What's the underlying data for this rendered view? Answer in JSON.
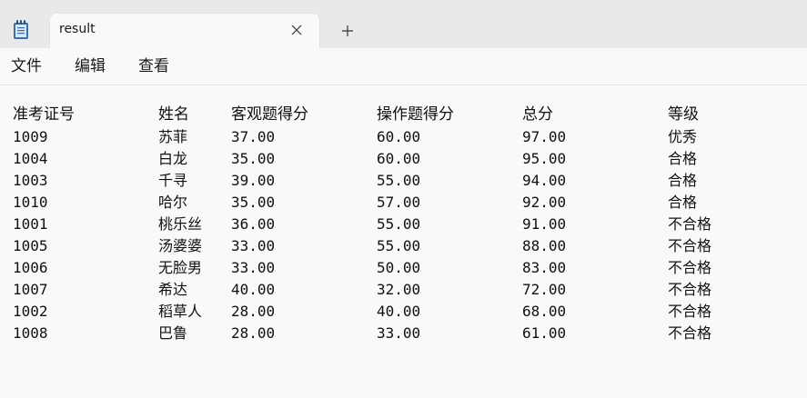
{
  "window": {
    "tab_title": "result",
    "icons": {
      "app": "notepad-icon",
      "close": "close-icon",
      "new_tab": "plus-icon"
    }
  },
  "menu": {
    "file": "文件",
    "edit": "编辑",
    "view": "查看"
  },
  "document": {
    "headers": [
      "准考证号",
      "姓名",
      "客观题得分",
      "操作题得分",
      "总分",
      "等级"
    ],
    "rows": [
      [
        "1009",
        "苏菲",
        "37.00",
        "60.00",
        "97.00",
        "优秀"
      ],
      [
        "1004",
        "白龙",
        "35.00",
        "60.00",
        "95.00",
        "合格"
      ],
      [
        "1003",
        "千寻",
        "39.00",
        "55.00",
        "94.00",
        "合格"
      ],
      [
        "1010",
        "哈尔",
        "35.00",
        "57.00",
        "92.00",
        "合格"
      ],
      [
        "1001",
        "桃乐丝",
        "36.00",
        "55.00",
        "91.00",
        "不合格"
      ],
      [
        "1005",
        "汤婆婆",
        "33.00",
        "55.00",
        "88.00",
        "不合格"
      ],
      [
        "1006",
        "无脸男",
        "33.00",
        "50.00",
        "83.00",
        "不合格"
      ],
      [
        "1007",
        "希达",
        "40.00",
        "32.00",
        "72.00",
        "不合格"
      ],
      [
        "1002",
        "稻草人",
        "28.00",
        "40.00",
        "68.00",
        "不合格"
      ],
      [
        "1008",
        "巴鲁",
        "28.00",
        "33.00",
        "61.00",
        "不合格"
      ]
    ]
  }
}
